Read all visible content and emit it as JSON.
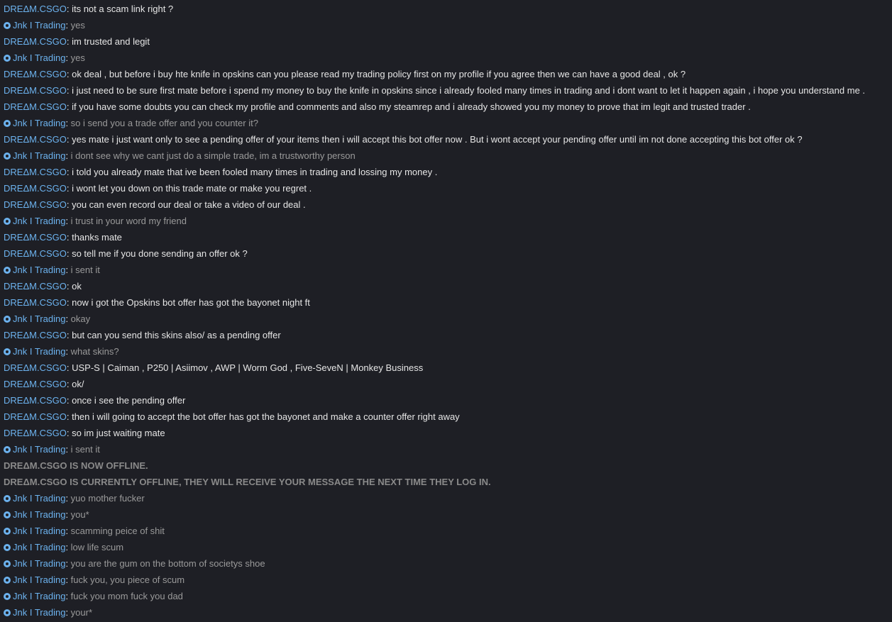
{
  "colors": {
    "background": "#1e1f25",
    "sender_name": "#6cb2ee",
    "their_text": "#e6e6e6",
    "my_text": "#9a9a9a",
    "system_text": "#8a8a8a"
  },
  "icons": {
    "self_badge": "friend-badge-icon"
  },
  "messages": [
    {
      "type": "dream",
      "sender": "DREΔM.CSGO",
      "text": "its not a scam link right ?"
    },
    {
      "type": "me",
      "sender": "Jnk I Trading",
      "text": "yes"
    },
    {
      "type": "dream",
      "sender": "DREΔM.CSGO",
      "text": "im trusted and legit"
    },
    {
      "type": "me",
      "sender": "Jnk I Trading",
      "text": "yes"
    },
    {
      "type": "dream",
      "sender": "DREΔM.CSGO",
      "text": "ok deal , but before i buy hte knife in opskins can you please read my trading policy first on my profile if you agree then we can have a good deal , ok ?"
    },
    {
      "type": "dream",
      "sender": "DREΔM.CSGO",
      "text": "i just need to be sure first mate before i spend my money to buy the knife in opskins since i already fooled many times in trading and i dont want to let it happen again , i hope you understand me ."
    },
    {
      "type": "dream",
      "sender": "DREΔM.CSGO",
      "text": "if you have some doubts you can check my profile and comments and also my steamrep and i already showed you my money to prove that im legit and trusted trader ."
    },
    {
      "type": "me",
      "sender": "Jnk I Trading",
      "text": "so i send you a trade offer and you counter it?"
    },
    {
      "type": "dream",
      "sender": "DREΔM.CSGO",
      "text": "yes mate i just want only to see a pending offer of your items then i will accept this bot offer now . But i wont accept your pending offer until im not done accepting this bot offer ok ?"
    },
    {
      "type": "me",
      "sender": "Jnk I Trading",
      "text": "i dont see why we cant just do a simple trade, im a trustworthy person"
    },
    {
      "type": "dream",
      "sender": "DREΔM.CSGO",
      "text": "i told you already mate that ive been fooled many times in trading and lossing my money ."
    },
    {
      "type": "dream",
      "sender": "DREΔM.CSGO",
      "text": "i wont let you down on this trade mate or make you regret ."
    },
    {
      "type": "dream",
      "sender": "DREΔM.CSGO",
      "text": "you can even record our deal or take a video of our deal ."
    },
    {
      "type": "me",
      "sender": "Jnk I Trading",
      "text": "i trust in your word my friend"
    },
    {
      "type": "dream",
      "sender": "DREΔM.CSGO",
      "text": "thanks mate"
    },
    {
      "type": "dream",
      "sender": "DREΔM.CSGO",
      "text": "so tell me if you done sending an offer ok ?"
    },
    {
      "type": "me",
      "sender": "Jnk I Trading",
      "text": "i sent it"
    },
    {
      "type": "dream",
      "sender": "DREΔM.CSGO",
      "text": "ok"
    },
    {
      "type": "dream",
      "sender": "DREΔM.CSGO",
      "text": "now i got the Opskins bot offer has got the bayonet night ft"
    },
    {
      "type": "me",
      "sender": "Jnk I Trading",
      "text": "okay"
    },
    {
      "type": "dream",
      "sender": "DREΔM.CSGO",
      "text": "but can you send this skins also/ as a pending offer"
    },
    {
      "type": "me",
      "sender": "Jnk I Trading",
      "text": "what skins?"
    },
    {
      "type": "dream",
      "sender": "DREΔM.CSGO",
      "text": "USP-S | Caiman , P250 | Asiimov , AWP | Worm God , Five-SeveN | Monkey Business"
    },
    {
      "type": "dream",
      "sender": "DREΔM.CSGO",
      "text": "ok/"
    },
    {
      "type": "dream",
      "sender": "DREΔM.CSGO",
      "text": "once i see the pending offer"
    },
    {
      "type": "dream",
      "sender": "DREΔM.CSGO",
      "text": "then i will going to accept the bot offer has got the bayonet and make a counter offer right away"
    },
    {
      "type": "dream",
      "sender": "DREΔM.CSGO",
      "text": "so im just waiting mate"
    },
    {
      "type": "me",
      "sender": "Jnk I Trading",
      "text": "i sent it"
    },
    {
      "type": "system",
      "text": "DREΔM.CSGO IS NOW OFFLINE."
    },
    {
      "type": "system",
      "text": "DREΔM.CSGO IS CURRENTLY OFFLINE, THEY WILL RECEIVE YOUR MESSAGE THE NEXT TIME THEY LOG IN."
    },
    {
      "type": "me",
      "sender": "Jnk I Trading",
      "text": "yuo mother fucker"
    },
    {
      "type": "me",
      "sender": "Jnk I Trading",
      "text": "you*"
    },
    {
      "type": "me",
      "sender": "Jnk I Trading",
      "text": "scamming peice of shit"
    },
    {
      "type": "me",
      "sender": "Jnk I Trading",
      "text": "low life scum"
    },
    {
      "type": "me",
      "sender": "Jnk I Trading",
      "text": "you are the gum on the bottom of societys shoe"
    },
    {
      "type": "me",
      "sender": "Jnk I Trading",
      "text": "fuck you, you piece of scum"
    },
    {
      "type": "me",
      "sender": "Jnk I Trading",
      "text": "fuck you mom fuck you dad"
    },
    {
      "type": "me",
      "sender": "Jnk I Trading",
      "text": "your*"
    }
  ]
}
